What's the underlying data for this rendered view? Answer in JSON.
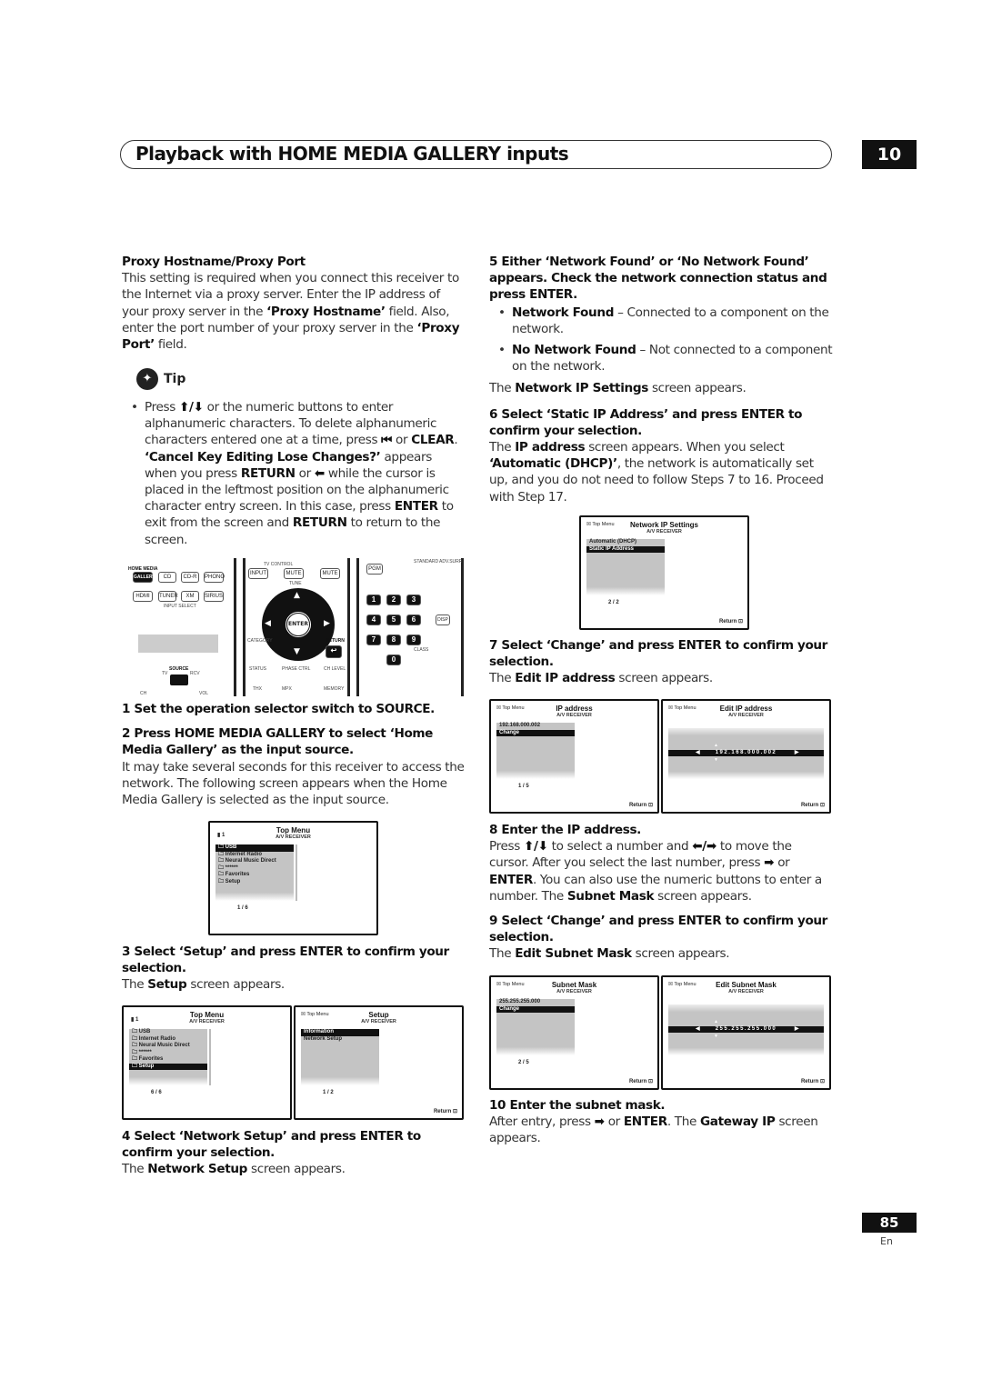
{
  "header": {
    "title": "Playback with HOME MEDIA GALLERY inputs",
    "chapter": "10"
  },
  "left": {
    "proxy_heading": "Proxy Hostname/Proxy Port",
    "proxy_text": [
      "This setting is required when you connect this receiver to the Internet via a proxy server. Enter the IP address of your proxy server in the ",
      "‘Proxy Hostname’",
      " field. Also, enter the port number of your proxy server in the ",
      "‘Proxy Port’",
      " field."
    ],
    "tip_label": "Tip",
    "tip_text": [
      "Press ",
      "⬆/⬇",
      " or the numeric buttons to enter alphanumeric characters. To delete alphanumeric characters entered one at a time, press ",
      "⏮",
      " or ",
      "CLEAR",
      ". ",
      "‘Cancel Key Editing Lose Changes?’",
      " appears when you press ",
      "RETURN",
      " or ",
      "⬅",
      " while the cursor is placed in the leftmost position on the alphanumeric character entry screen. In this case, press ",
      "ENTER",
      " to exit from the screen and ",
      "RETURN",
      " to return to the screen."
    ],
    "step1": "1   Set the operation selector switch to SOURCE.",
    "step2": "2   Press HOME MEDIA GALLERY to select ‘Home Media Gallery’ as the input source.",
    "step2_text": "It may take several seconds for this receiver to access the network. The following screen appears when the Home Media Gallery is selected as the input source.",
    "step3": "3   Select ‘Setup’ and press ENTER to confirm your selection.",
    "step3_text": [
      "The ",
      "Setup",
      " screen appears."
    ],
    "step4": "4   Select ‘Network Setup’ and press ENTER to confirm your selection.",
    "step4_text": [
      "The ",
      "Network Setup",
      " screen appears."
    ]
  },
  "right": {
    "step5": "5   Either ‘Network Found’ or ‘No Network Found’ appears. Check the network connection status and press ENTER.",
    "bullets": [
      [
        "Network Found",
        " – Connected to a component on the network."
      ],
      [
        "No Network Found",
        " – Not connected to a component on the network."
      ]
    ],
    "step5_text": [
      "The ",
      "Network IP Settings",
      " screen appears."
    ],
    "step6": "6   Select ‘Static IP Address’ and press ENTER to confirm your selection.",
    "step6_text": [
      "The ",
      "IP address",
      " screen appears. When you select ",
      "‘Automatic (DHCP)’",
      ", the network is automatically set up, and you do not need to follow Steps 7 to 16. Proceed with Step 17."
    ],
    "step7": "7   Select ‘Change’ and press ENTER to confirm your selection.",
    "step7_text": [
      "The ",
      "Edit IP address",
      " screen appears."
    ],
    "step8": "8   Enter the IP address.",
    "step8_text": [
      "Press ",
      "⬆/⬇",
      " to select a number and ",
      "⬅/➡",
      " to move the cursor. After you select the last number, press ",
      "➡",
      " or ",
      "ENTER",
      ". You can also use the numeric buttons to enter a number. The ",
      "Subnet Mask",
      " screen appears."
    ],
    "step9": "9   Select ‘Change’ and press ENTER to confirm your selection.",
    "step9_text": [
      "The ",
      "Edit Subnet Mask",
      " screen appears."
    ],
    "step10": "10  Enter the subnet mask.",
    "step10_text": [
      "After entry, press ",
      "➡",
      " or ",
      "ENTER",
      ". The ",
      "Gateway IP",
      " screen appears."
    ]
  },
  "remote": {
    "home_media": "HOME MEDIA",
    "gallery": "GALLERY",
    "buttons": [
      "CD",
      "CD-R",
      "PHONO",
      "HDMI",
      "TUNER",
      "XM",
      "SIRIUS"
    ],
    "input_select": "INPUT SELECT",
    "tv_control": "TV CONTROL",
    "input": "INPUT",
    "mute": "MUTE",
    "tune": "TUNE",
    "enter": "ENTER",
    "return": "RETURN",
    "source": "SOURCE",
    "tv": "TV",
    "rcv": "RCV",
    "ch": "CH",
    "vol": "VOL",
    "pgm": "PGM",
    "standard": "STANDARD",
    "adv_surr": "ADV.SURR",
    "digits": [
      "1",
      "2",
      "3",
      "4",
      "5",
      "6",
      "7",
      "8",
      "9",
      "0"
    ],
    "disp": "DISP",
    "class": "CLASS",
    "status": "STATUS",
    "phase_ctrl": "PHASE CTRL",
    "ch_level": "CH LEVEL",
    "category": "CATEGORY",
    "thx": "THX",
    "mpx": "MPX",
    "memory": "MEMORY"
  },
  "screens": [
    {
      "title": "Top Menu",
      "subtitle": "A/V RECEIVER",
      "device": "1",
      "items": [
        "USB",
        "Internet Radio",
        "Neural Music Direct",
        "******",
        "Favorites",
        "Setup"
      ],
      "selected": 0,
      "page": "1 / 6",
      "folders": true
    },
    {
      "title": "Top Menu",
      "subtitle": "A/V RECEIVER",
      "device": "1",
      "items": [
        "USB",
        "Internet Radio",
        "Neural Music Direct",
        "******",
        "Favorites",
        "Setup"
      ],
      "selected": 5,
      "page": "6 / 6",
      "folders": true
    },
    {
      "title": "Setup",
      "subtitle": "A/V RECEIVER",
      "topmenu": "Top Menu",
      "items": [
        "Information",
        "Network Setup"
      ],
      "selected": 0,
      "page": "1 / 2",
      "return": "Return"
    },
    {
      "title": "Network IP Settings",
      "subtitle": "A/V RECEIVER",
      "topmenu": "Top Menu",
      "items": [
        "Automatic (DHCP)",
        "Static IP Address"
      ],
      "selected": 1,
      "page": "2 / 2",
      "return": "Return"
    },
    {
      "title": "IP address",
      "subtitle": "A/V RECEIVER",
      "topmenu": "Top Menu",
      "items": [
        "192.168.000.002",
        "Change"
      ],
      "selected": 1,
      "page": "1 / 5",
      "return": "Return"
    },
    {
      "title": "Edit IP address",
      "subtitle": "A/V RECEIVER",
      "topmenu": "Top Menu",
      "edit": "192.168.000.002",
      "return": "Return"
    },
    {
      "title": "Subnet Mask",
      "subtitle": "A/V RECEIVER",
      "topmenu": "Top Menu",
      "items": [
        "255.255.255.000",
        "Change"
      ],
      "selected": 1,
      "page": "2 / 5",
      "return": "Return"
    },
    {
      "title": "Edit Subnet Mask",
      "subtitle": "A/V RECEIVER",
      "topmenu": "Top Menu",
      "edit": "255.255.255.000",
      "return": "Return"
    }
  ],
  "footer": {
    "page_number": "85",
    "lang": "En"
  }
}
